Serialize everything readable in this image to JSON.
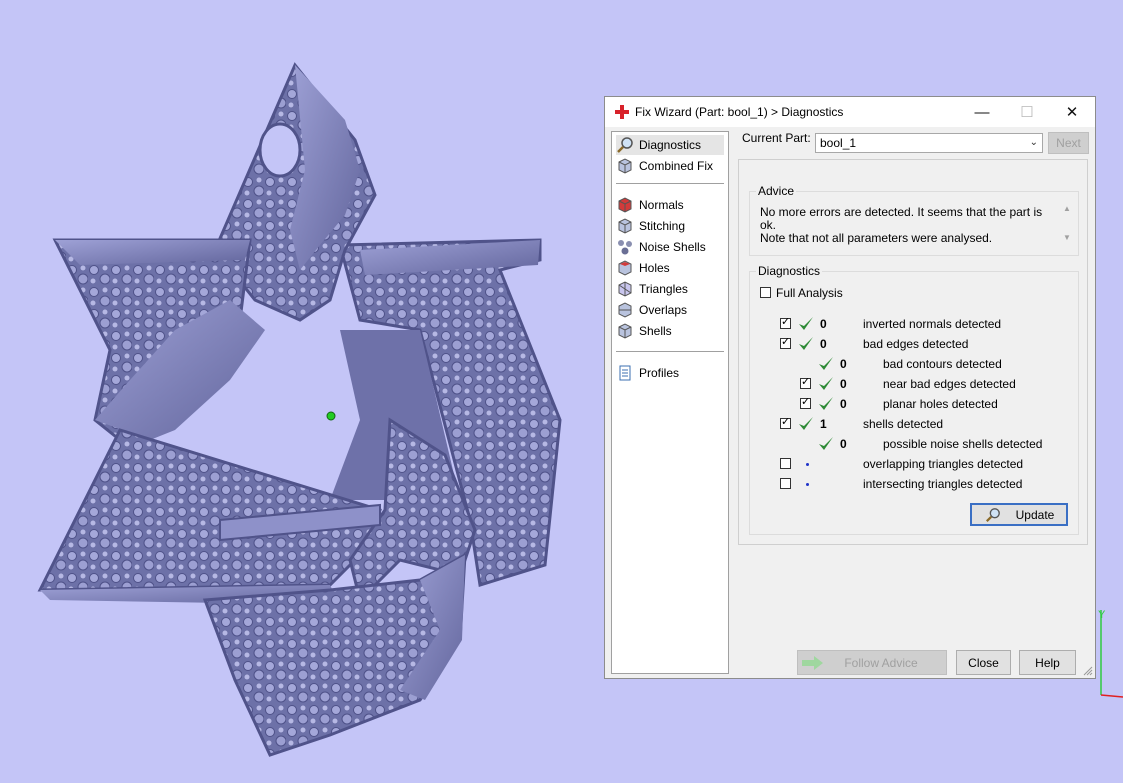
{
  "dialog": {
    "title": "Fix Wizard (Part: bool_1) > Diagnostics",
    "window_buttons": {
      "minimize": "—",
      "maximize": "☐",
      "close": "✕"
    }
  },
  "nav": {
    "top_items": [
      {
        "label": "Diagnostics",
        "icon": "magnifier-icon",
        "selected": true
      },
      {
        "label": "Combined Fix",
        "icon": "combined-fix-icon"
      }
    ],
    "fix_items": [
      {
        "label": "Normals",
        "icon": "normals-icon"
      },
      {
        "label": "Stitching",
        "icon": "stitching-icon"
      },
      {
        "label": "Noise Shells",
        "icon": "noise-shells-icon"
      },
      {
        "label": "Holes",
        "icon": "holes-icon"
      },
      {
        "label": "Triangles",
        "icon": "triangles-icon"
      },
      {
        "label": "Overlaps",
        "icon": "overlaps-icon"
      },
      {
        "label": "Shells",
        "icon": "shells-icon"
      }
    ],
    "bottom_items": [
      {
        "label": "Profiles",
        "icon": "profiles-icon"
      }
    ]
  },
  "current_part": {
    "label": "Current Part:",
    "value": "bool_1",
    "next_label": "Next"
  },
  "advice": {
    "title": "Advice",
    "line1": "No more errors are detected. It seems that the part is ok.",
    "line2": "Note that not all parameters were analysed."
  },
  "diagnostics": {
    "title": "Diagnostics",
    "full_analysis_label": "Full Analysis",
    "full_analysis_checked": false,
    "rows": [
      {
        "label": "inverted normals detected",
        "count": "0",
        "checked": true,
        "status": "ok",
        "level": 0
      },
      {
        "label": "bad edges detected",
        "count": "0",
        "checked": true,
        "status": "ok",
        "level": 0
      },
      {
        "label": "bad contours detected",
        "count": "0",
        "checked": null,
        "status": "ok",
        "level": 1
      },
      {
        "label": "near bad edges detected",
        "count": "0",
        "checked": true,
        "status": "ok",
        "level": 1
      },
      {
        "label": "planar holes detected",
        "count": "0",
        "checked": true,
        "status": "ok",
        "level": 1
      },
      {
        "label": "shells detected",
        "count": "1",
        "checked": true,
        "status": "ok",
        "level": 0
      },
      {
        "label": "possible noise shells detected",
        "count": "0",
        "checked": null,
        "status": "ok",
        "level": 1
      },
      {
        "label": "overlapping triangles detected",
        "count": "",
        "checked": false,
        "status": "pending",
        "level": 0
      },
      {
        "label": "intersecting triangles detected",
        "count": "",
        "checked": false,
        "status": "pending",
        "level": 0
      }
    ],
    "update_label": "Update"
  },
  "footer": {
    "follow_advice_label": "Follow Advice",
    "close_label": "Close",
    "help_label": "Help"
  },
  "colors": {
    "background": "#c4c5f7",
    "model": "#7c80b8",
    "check_green": "#2d8a35",
    "pivot_green": "#22cc22"
  }
}
